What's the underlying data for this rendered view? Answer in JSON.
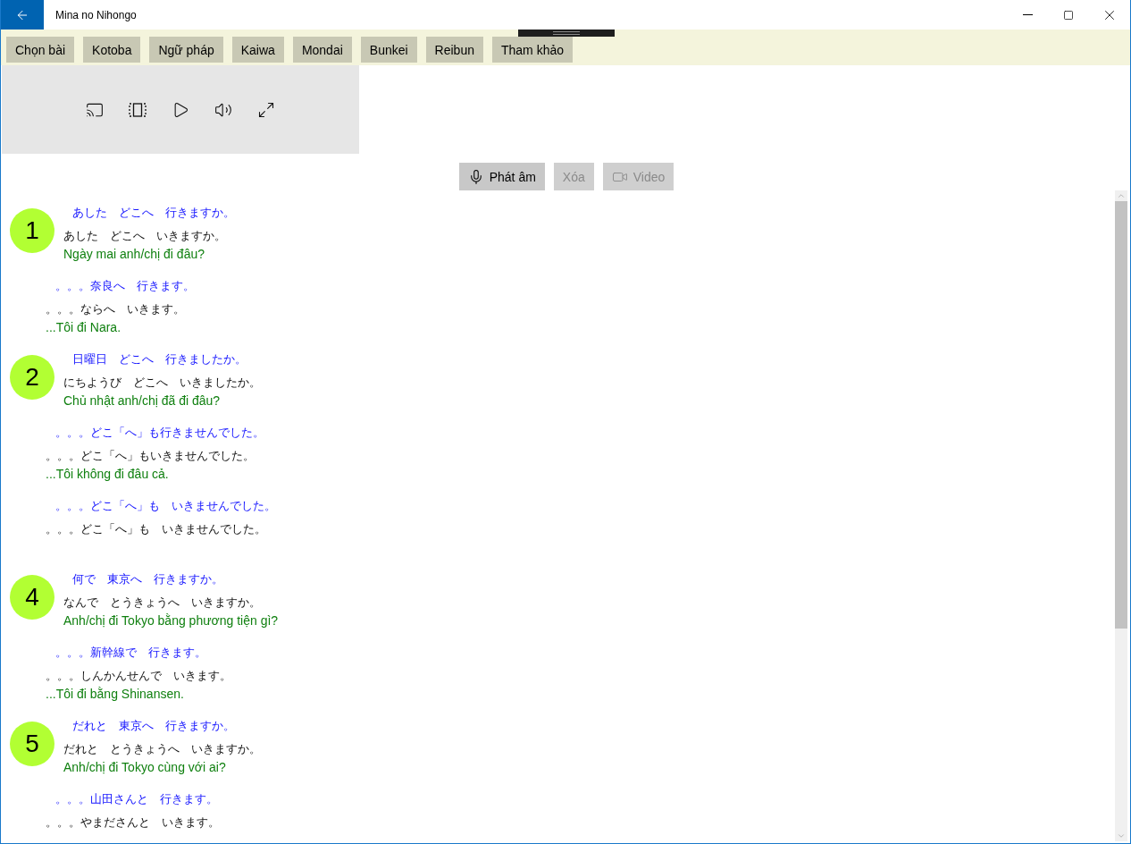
{
  "window": {
    "title": "Mina no Nihongo"
  },
  "tabs": [
    {
      "label": "Chọn bài"
    },
    {
      "label": "Kotoba"
    },
    {
      "label": "Ngữ pháp"
    },
    {
      "label": "Kaiwa"
    },
    {
      "label": "Mondai"
    },
    {
      "label": "Bunkei"
    },
    {
      "label": "Reibun"
    },
    {
      "label": "Tham khảo"
    }
  ],
  "actions": [
    {
      "label": "Phát âm",
      "kind": "mic",
      "disabled": false
    },
    {
      "label": "Xóa",
      "kind": "plain",
      "disabled": true
    },
    {
      "label": "Video",
      "kind": "video",
      "disabled": true
    }
  ],
  "entries": [
    {
      "kind": "question",
      "number": "1",
      "kanji": "あした　どこへ　行きますか。",
      "kana": "あした　どこへ　いきますか。",
      "meaning": "Ngày mai anh/chị đi đâu?"
    },
    {
      "kind": "answer",
      "kanji": "。。。奈良へ　行きます。",
      "kana": "。。。ならへ　いきます。",
      "meaning": "...Tôi đi Nara."
    },
    {
      "kind": "question",
      "number": "2",
      "kanji": "日曜日　どこへ　行きましたか。",
      "kana": "にちようび　どこへ　いきましたか。",
      "meaning": "Chủ nhật anh/chị đã đi đâu?"
    },
    {
      "kind": "answer",
      "kanji": "。。。どこ「へ」も行きませんでした。",
      "kana": "。。。どこ「へ」もいきませんでした。",
      "meaning": "...Tôi không đi đâu cả."
    },
    {
      "kind": "answer",
      "kanji": "。。。どこ「へ」も　いきませんでした。",
      "kana": "。。。どこ「へ」も　いきませんでした。"
    },
    {
      "kind": "question",
      "number": "4",
      "kanji": "何で　東京へ　行きますか。",
      "kana": "なんで　とうきょうへ　いきますか。",
      "meaning": "Anh/chị đi Tokyo bằng phương tiện gì?"
    },
    {
      "kind": "answer",
      "kanji": "。。。新幹線で　行きます。",
      "kana": "。。。しんかんせんで　いきます。",
      "meaning": "...Tôi đi bằng Shinansen."
    },
    {
      "kind": "question",
      "number": "5",
      "kanji": "だれと　東京へ　行きますか。",
      "kana": "だれと　とうきょうへ　いきますか。",
      "meaning": "Anh/chị đi Tokyo cùng với ai?"
    },
    {
      "kind": "answer",
      "kanji": "。。。山田さんと　行きます。",
      "kana": "。。。やまださんと　いきます。"
    }
  ]
}
